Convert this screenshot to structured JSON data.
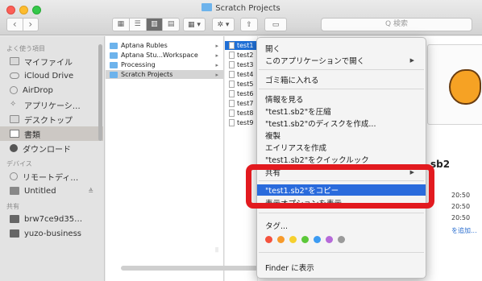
{
  "window": {
    "title": "Scratch Projects",
    "nav": {
      "back": "‹",
      "forward": "›"
    },
    "view_buttons": [
      "▦",
      "☰",
      "▥",
      "▤"
    ],
    "group_button": "▦ ▾",
    "action_button": "✲ ▾",
    "share_button": "⇧",
    "tag_button": "▭",
    "search_placeholder": "Q 検索"
  },
  "sidebar": {
    "favorites_header": "よく使う項目",
    "favorites": [
      {
        "label": "マイファイル",
        "icon": "all-my-files-icon"
      },
      {
        "label": "iCloud Drive",
        "icon": "icloud-icon"
      },
      {
        "label": "AirDrop",
        "icon": "airdrop-icon"
      },
      {
        "label": "アプリケーシ…",
        "icon": "applications-icon"
      },
      {
        "label": "デスクトップ",
        "icon": "desktop-icon"
      },
      {
        "label": "書類",
        "icon": "documents-icon"
      },
      {
        "label": "ダウンロード",
        "icon": "downloads-icon"
      }
    ],
    "devices_header": "デバイス",
    "devices": [
      {
        "label": "リモートディ…",
        "icon": "remote-disc-icon"
      },
      {
        "label": "Untitled",
        "icon": "disk-icon",
        "eject": "≜"
      }
    ],
    "shared_header": "共有",
    "shared": [
      {
        "label": "brw7ce9d35…",
        "icon": "network-computer-icon"
      },
      {
        "label": "yuzo-business",
        "icon": "network-computer-icon"
      }
    ]
  },
  "column1": {
    "items": [
      {
        "label": "Aptana Rubles",
        "arrow": "▸"
      },
      {
        "label": "Aptana Stu...Workspace",
        "arrow": "▸"
      },
      {
        "label": "Processing",
        "arrow": "▸"
      },
      {
        "label": "Scratch Projects",
        "arrow": "▸"
      }
    ],
    "splitter": "||"
  },
  "column2": {
    "items": [
      "test1",
      "test2",
      "test3",
      "test4",
      "test5",
      "test6",
      "test7",
      "test8",
      "test9"
    ]
  },
  "preview": {
    "name": "sb2",
    "times": [
      "20:50",
      "20:50",
      "20:50"
    ],
    "add_tags": "を追加..."
  },
  "context_menu": {
    "items": [
      {
        "label": "開く"
      },
      {
        "label": "このアプリケーションで開く",
        "sub": "▶"
      },
      {
        "label": "ゴミ箱に入れる"
      },
      {
        "label": "情報を見る"
      },
      {
        "label": "\"test1.sb2\"を圧縮"
      },
      {
        "label": "\"test1.sb2\"のディスクを作成..."
      },
      {
        "label": "複製"
      },
      {
        "label": "エイリアスを作成"
      },
      {
        "label": "\"test1.sb2\"をクイックルック"
      },
      {
        "label": "共有",
        "sub": "▶"
      },
      {
        "label": "\"test1.sb2\"をコピー"
      },
      {
        "label": "表示オプションを表示"
      },
      {
        "label": "タグ..."
      },
      {
        "label": "Finder に表示"
      }
    ],
    "tag_colors": [
      "#f4523d",
      "#f79a2b",
      "#f6d02e",
      "#5cc839",
      "#3c9bf2",
      "#b66ad9",
      "#9a9a9a"
    ]
  },
  "annotation_color": "#e21a1f"
}
